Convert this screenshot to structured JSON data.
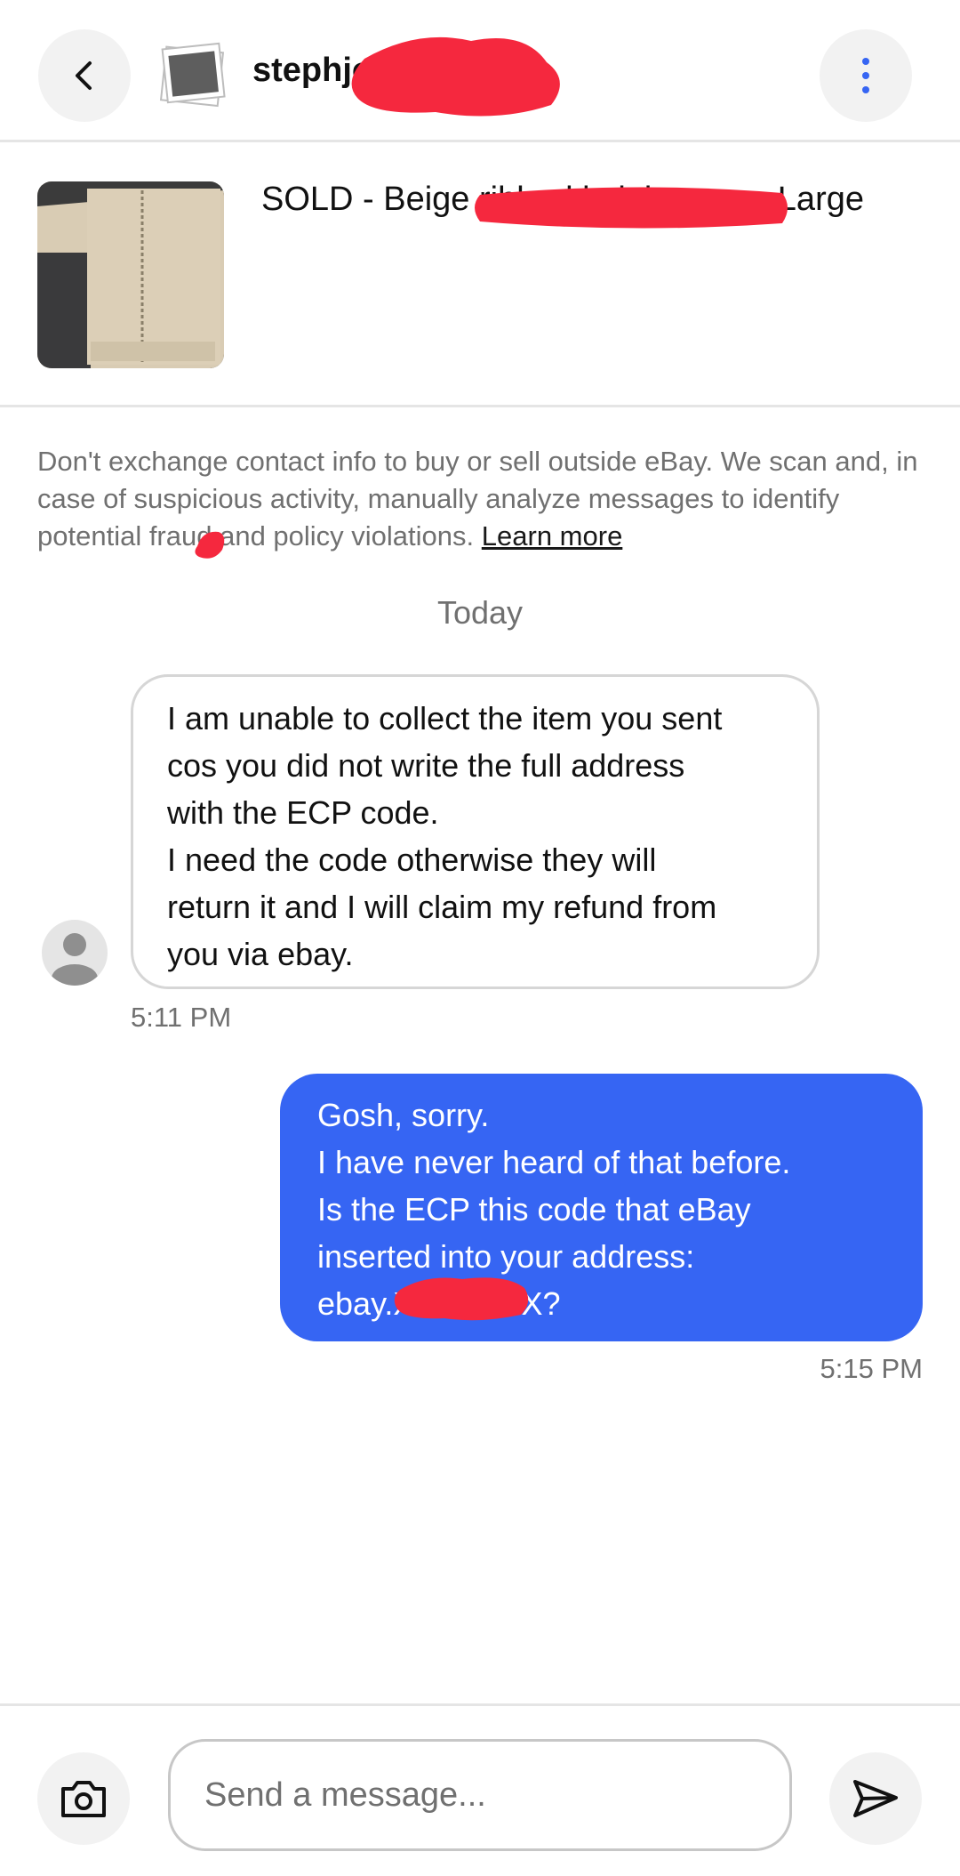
{
  "header": {
    "back_icon": "chevron-left-icon",
    "username": "stephjo",
    "more_icon": "more-vertical-icon"
  },
  "listing": {
    "title": "SOLD - Beige ribbed knit jumper - Large"
  },
  "notice": {
    "text": "Don't exchange contact info to buy or sell outside eBay. We scan and, in case of suspicious activity, manually analyze messages to identify potential fraud and policy violations.",
    "link_label": "Learn more"
  },
  "day_label": "Today",
  "messages": [
    {
      "direction": "incoming",
      "lines": [
        "I am unable to collect the item you sent",
        "cos you did not write the full address",
        "with the ECP code.",
        "I need the code otherwise they will",
        "return it and I will claim my refund from",
        "you via ebay."
      ],
      "time": "5:11 PM"
    },
    {
      "direction": "outgoing",
      "lines": [
        "Gosh, sorry.",
        "I have never heard of that before.",
        "Is the ECP this code that eBay",
        "inserted into your address:",
        "ebay.XXXXXXX?"
      ],
      "time": "5:15 PM"
    }
  ],
  "composer": {
    "placeholder": "Send a message...",
    "camera_icon": "camera-icon",
    "send_icon": "send-icon"
  },
  "colors": {
    "accent": "#3665f3",
    "redaction": "#f5283e",
    "muted_text": "#707070"
  }
}
